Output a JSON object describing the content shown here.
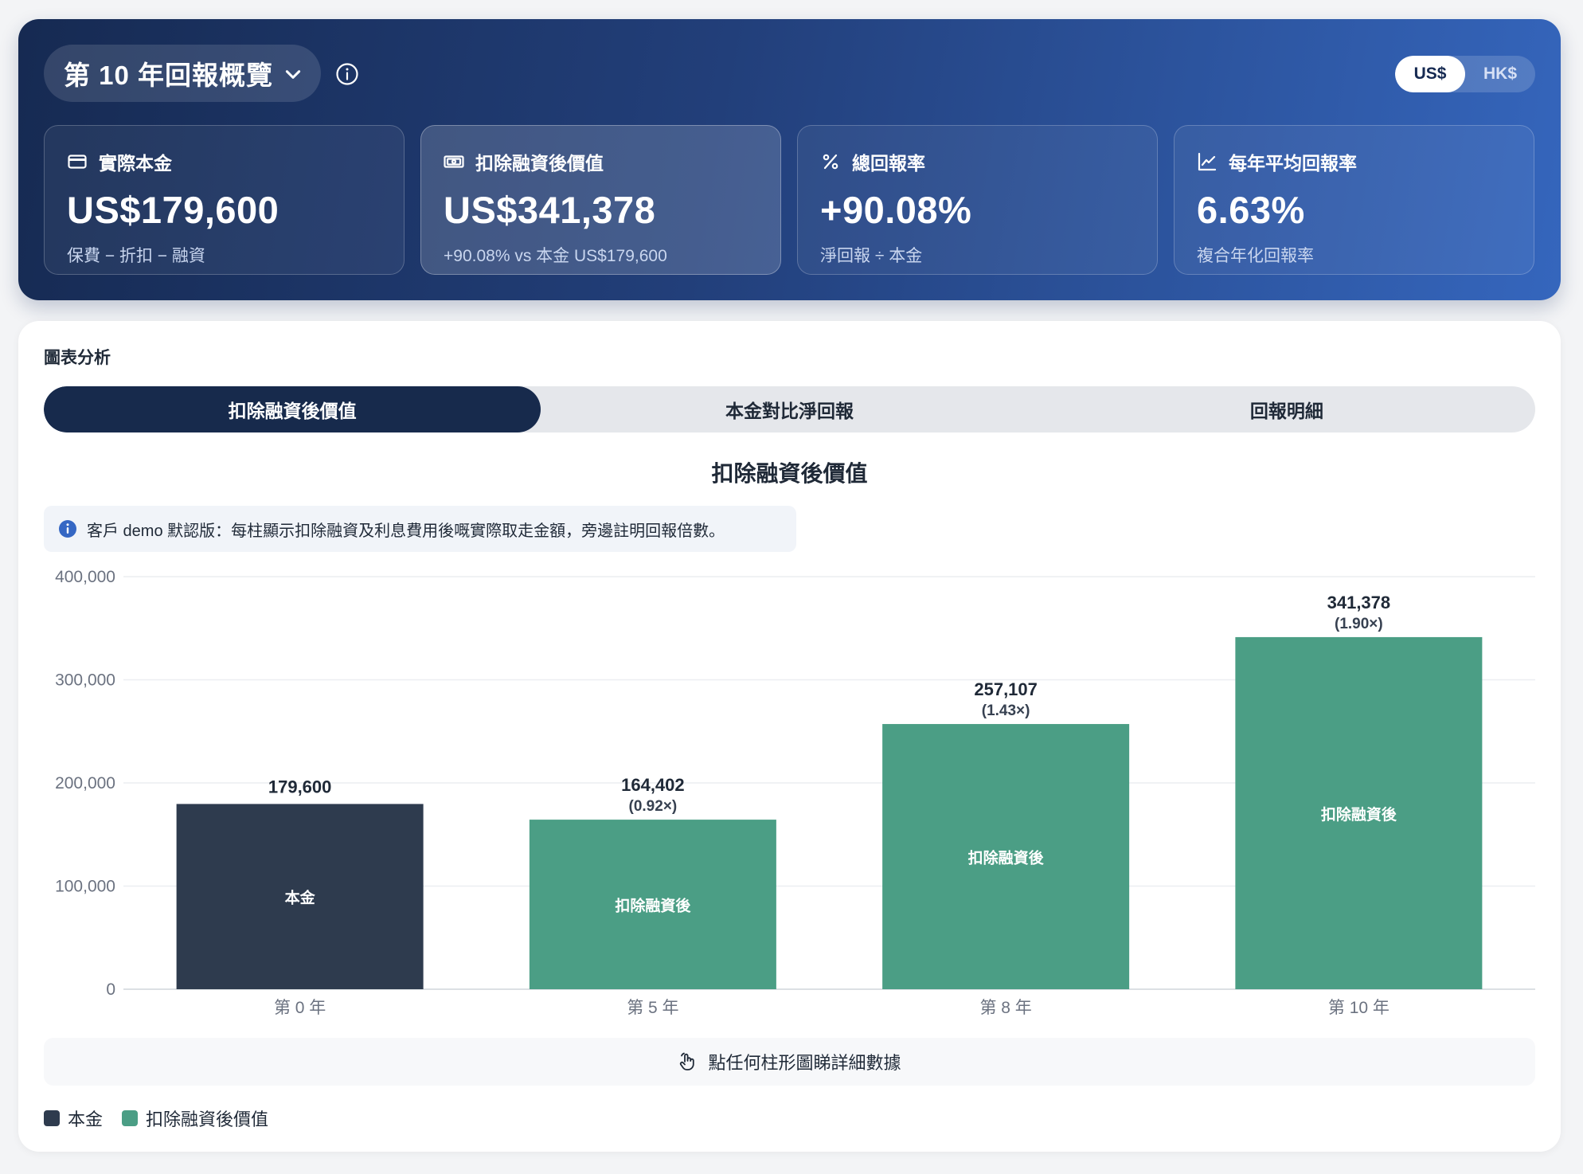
{
  "header": {
    "title": "第 10 年回報概覽",
    "currency_options": [
      "US$",
      "HK$"
    ],
    "currency_selected": "US$"
  },
  "stats": [
    {
      "icon": "credit-card-icon",
      "label": "實際本金",
      "value": "US$179,600",
      "sub": "保費 − 折扣 − 融資"
    },
    {
      "icon": "banknote-icon",
      "label": "扣除融資後價值",
      "value": "US$341,378",
      "sub": "+90.08% vs 本金 US$179,600"
    },
    {
      "icon": "percent-icon",
      "label": "總回報率",
      "value": "+90.08%",
      "sub": "淨回報 ÷ 本金"
    },
    {
      "icon": "trend-chart-icon",
      "label": "每年平均回報率",
      "value": "6.63%",
      "sub": "複合年化回報率"
    }
  ],
  "panel": {
    "section_label": "圖表分析",
    "tabs": [
      "扣除融資後價值",
      "本金對比淨回報",
      "回報明細"
    ],
    "active_tab": 0,
    "note": "客戶 demo 默認版：每柱顯示扣除融資及利息費用後嘅實際取走金額，旁邊註明回報倍數。",
    "hint": "點任何柱形圖睇詳細數據"
  },
  "colors": {
    "principal": "#2e3b4e",
    "net_value": "#4b9e85",
    "hero_start": "#162a52",
    "hero_end": "#3566bd"
  },
  "chart_data": {
    "type": "bar",
    "title": "扣除融資後價值",
    "categories": [
      "第 0 年",
      "第 5 年",
      "第 8 年",
      "第 10 年"
    ],
    "values": [
      179600,
      164402,
      257107,
      341378
    ],
    "value_labels": [
      "179,600",
      "164,402",
      "257,107",
      "341,378"
    ],
    "multiples": [
      "",
      "(0.92×)",
      "(1.43×)",
      "(1.90×)"
    ],
    "bar_labels": [
      "本金",
      "扣除融資後",
      "扣除融資後",
      "扣除融資後"
    ],
    "bar_series": [
      "principal",
      "net_value",
      "net_value",
      "net_value"
    ],
    "y_ticks": [
      0,
      100000,
      200000,
      300000,
      400000
    ],
    "y_tick_labels": [
      "0",
      "100,000",
      "200,000",
      "300,000",
      "400,000"
    ],
    "ylim": [
      0,
      400000
    ],
    "grid": true,
    "legend": [
      {
        "name": "本金",
        "series": "principal"
      },
      {
        "name": "扣除融資後價值",
        "series": "net_value"
      }
    ],
    "legend_position": "bottom-left"
  }
}
